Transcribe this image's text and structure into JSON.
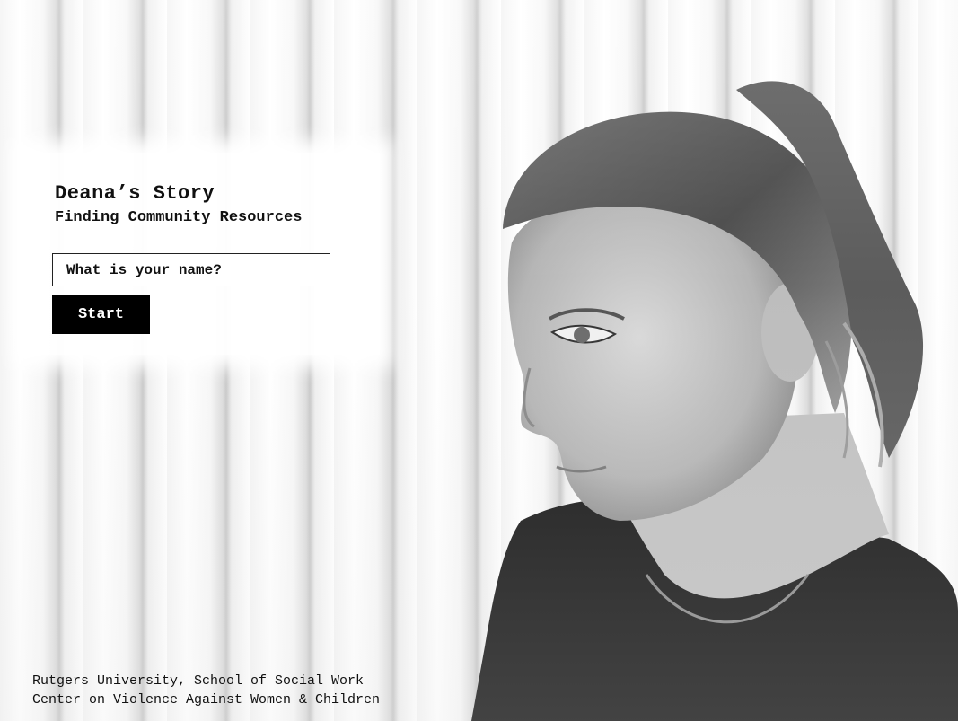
{
  "story": {
    "title": "Deana’s Story",
    "subtitle": "Finding Community Resources"
  },
  "name_input": {
    "placeholder": "What is your name?",
    "value": ""
  },
  "start_button": {
    "label": "Start"
  },
  "footer": {
    "line1": "Rutgers University, School of Social Work",
    "line2": "Center on Violence Against Women & Children"
  },
  "colors": {
    "button_background": "#000000",
    "button_text": "#ffffff",
    "panel_background": "#ffffff"
  }
}
